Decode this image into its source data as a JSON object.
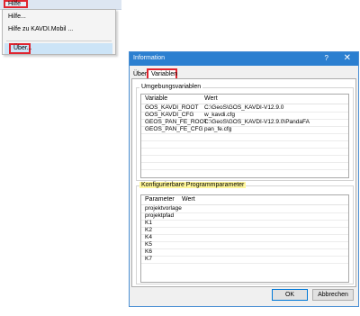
{
  "menubar": {
    "hilfe_label": "Hilfe"
  },
  "dropdown": {
    "items": [
      "Hilfe...",
      "Hilfe zu KAVDI.Mobil ...",
      "Über..."
    ]
  },
  "dialog": {
    "title": "Information",
    "help_glyph": "?",
    "close_glyph": "✕",
    "tabs": [
      "Über",
      "Variablen"
    ],
    "env_group": {
      "legend": "Umgebungsvariablen",
      "columns": [
        "Variable",
        "Wert"
      ],
      "rows": [
        [
          "GOS_KAVDI_ROOT",
          "C:\\GeoS\\GOS_KAVDI-V12.9.0"
        ],
        [
          "GOS_KAVDI_CFG",
          "w_kavdi.cfg"
        ],
        [
          "GEOS_PAN_FE_ROOT",
          "C:\\GeoS\\GOS_KAVDI-V12.9.0\\PandaFA"
        ],
        [
          "GEOS_PAN_FE_CFG",
          "pan_fe.cfg"
        ]
      ]
    },
    "param_group": {
      "legend": "Konfigurierbare Programmparameter",
      "columns": [
        "Parameter",
        "Wert"
      ],
      "rows": [
        [
          "projektvorlage",
          ""
        ],
        [
          "projektpfad",
          ""
        ],
        [
          "K1",
          ""
        ],
        [
          "K2",
          ""
        ],
        [
          "K4",
          ""
        ],
        [
          "K5",
          ""
        ],
        [
          "K6",
          ""
        ],
        [
          "K7",
          ""
        ]
      ]
    },
    "buttons": {
      "ok": "OK",
      "cancel": "Abbrechen"
    }
  }
}
